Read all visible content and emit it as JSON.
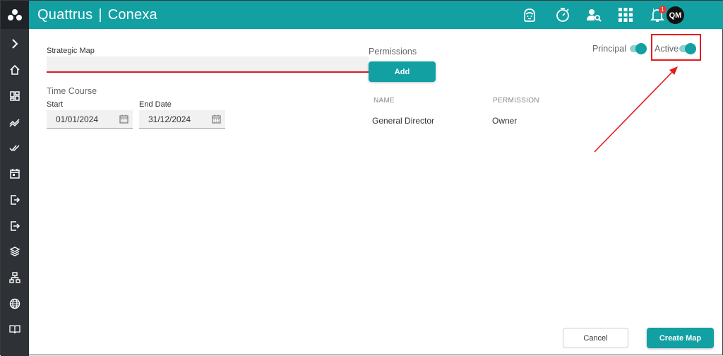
{
  "header": {
    "brand_left": "Quattrus",
    "brand_separator": "|",
    "brand_right": "Conexa",
    "notification_count": "1",
    "user_initials": "QM"
  },
  "sidebar": {
    "items": [
      "expand",
      "home",
      "dashboard",
      "trend",
      "tasks",
      "calendar",
      "import",
      "export",
      "layers",
      "hierarchy",
      "globe",
      "book"
    ]
  },
  "form": {
    "strategic_map_label": "Strategic Map",
    "strategic_map_value": "",
    "time_course_label": "Time Course",
    "start_label": "Start",
    "start_value": "01/01/2024",
    "end_label": "End Date",
    "end_value": "31/12/2024"
  },
  "permissions": {
    "title": "Permissions",
    "add_label": "Add",
    "columns": [
      "NAME",
      "PERMISSION"
    ],
    "rows": [
      [
        "General Director",
        "Owner"
      ]
    ]
  },
  "toggles": {
    "principal_label": "Principal",
    "principal_on": true,
    "active_label": "Active",
    "active_on": true
  },
  "footer": {
    "cancel_label": "Cancel",
    "create_label": "Create Map"
  },
  "colors": {
    "brand": "#12a0a3",
    "sidebar": "#2e3136",
    "error_underline": "#d11f26",
    "annotation": "#e41b1b"
  }
}
